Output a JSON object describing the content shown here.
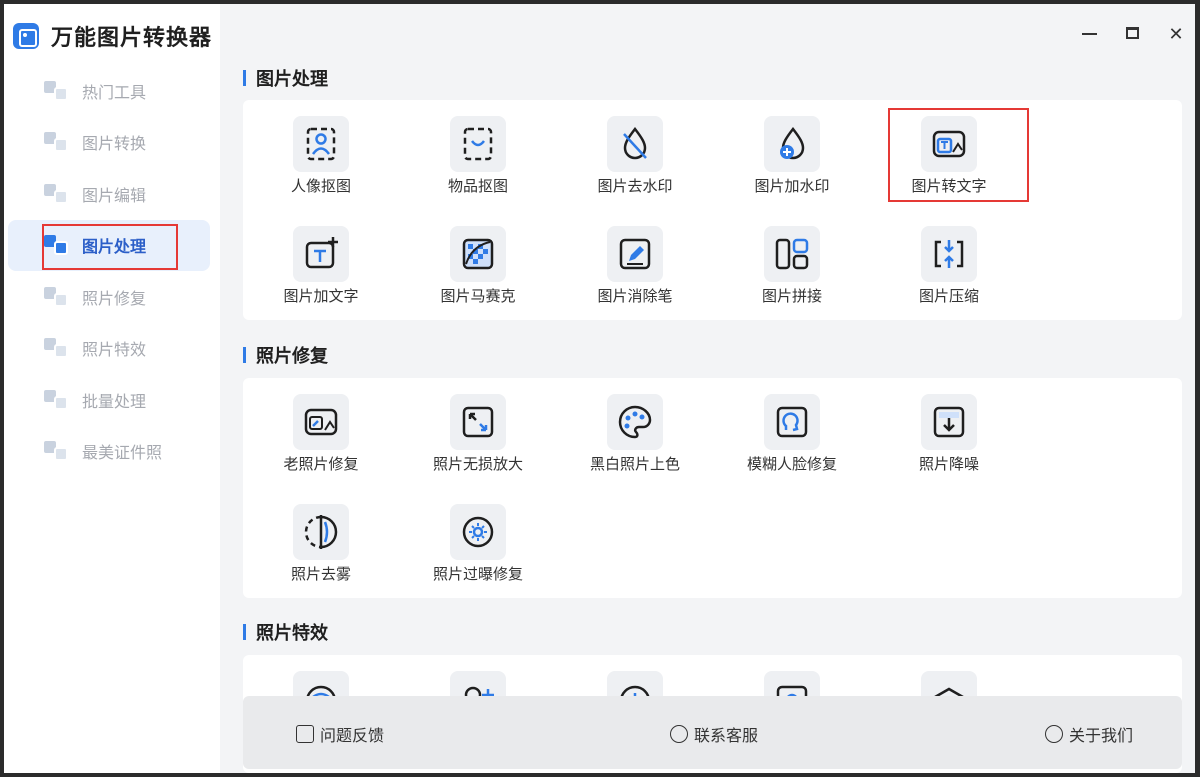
{
  "app": {
    "name": "万能图片转换器"
  },
  "sidebar": {
    "items": [
      {
        "label": "热门工具",
        "icon": "hot-tools-icon"
      },
      {
        "label": "图片转换",
        "icon": "image-convert-icon"
      },
      {
        "label": "图片编辑",
        "icon": "image-edit-icon"
      },
      {
        "label": "图片处理",
        "icon": "image-process-icon",
        "active": true
      },
      {
        "label": "照片修复",
        "icon": "photo-repair-icon"
      },
      {
        "label": "照片特效",
        "icon": "photo-effects-icon"
      },
      {
        "label": "批量处理",
        "icon": "batch-process-icon"
      },
      {
        "label": "最美证件照",
        "icon": "id-photo-icon"
      }
    ]
  },
  "sections": {
    "image_process": {
      "title": "图片处理",
      "tools": [
        "人像抠图",
        "物品抠图",
        "图片去水印",
        "图片加水印",
        "图片转文字",
        "图片加文字",
        "图片马赛克",
        "图片消除笔",
        "图片拼接",
        "图片压缩"
      ]
    },
    "photo_repair": {
      "title": "照片修复",
      "tools": [
        "老照片修复",
        "照片无损放大",
        "黑白照片上色",
        "模糊人脸修复",
        "照片降噪",
        "照片去雾",
        "照片过曝修复"
      ]
    },
    "photo_effects": {
      "title": "照片特效"
    }
  },
  "footer": {
    "feedback": "问题反馈",
    "support": "联系客服",
    "about": "关于我们"
  },
  "colors": {
    "accent": "#2f7be6",
    "highlight": "#e53935"
  }
}
